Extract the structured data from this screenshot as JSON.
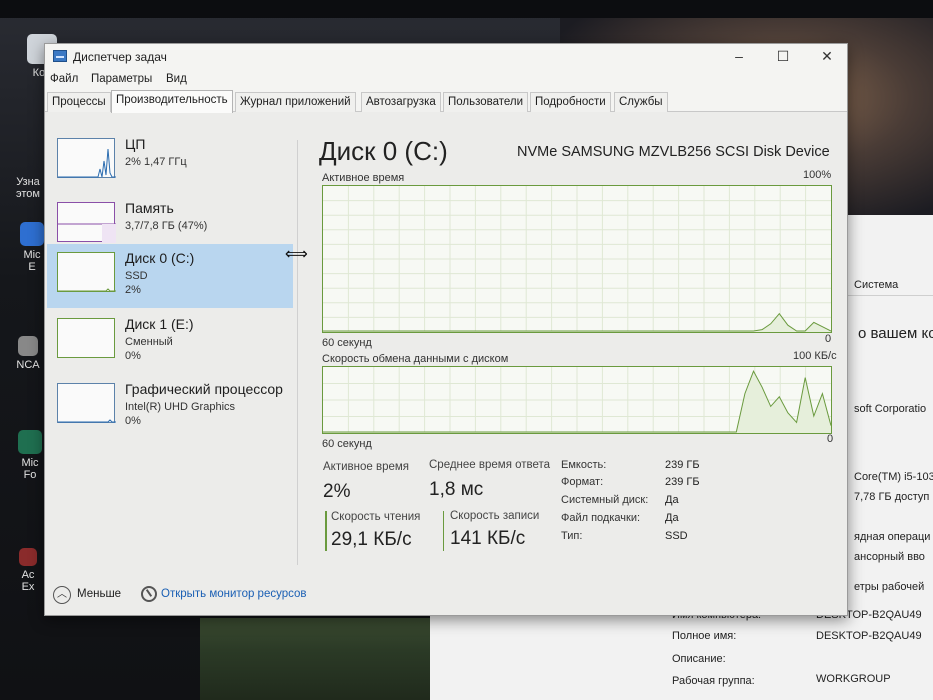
{
  "window": {
    "title": "Диспетчер задач",
    "controls": {
      "minimize": "–",
      "maximize": "☐",
      "close": "✕"
    }
  },
  "menu": [
    "Файл",
    "Параметры",
    "Вид"
  ],
  "tabs": [
    "Процессы",
    "Производительность",
    "Журнал приложений",
    "Автозагрузка",
    "Пользователи",
    "Подробности",
    "Службы"
  ],
  "active_tab": "Производительность",
  "sidebar": {
    "items": [
      {
        "name": "ЦП",
        "line1": "2% 1,47 ГГц",
        "line2": ""
      },
      {
        "name": "Память",
        "line1": "3,7/7,8 ГБ (47%)",
        "line2": ""
      },
      {
        "name": "Диск 0 (C:)",
        "line1": "SSD",
        "line2": "2%"
      },
      {
        "name": "Диск 1 (E:)",
        "line1": "Сменный",
        "line2": "0%"
      },
      {
        "name": "Графический процессор",
        "line1": "Intel(R) UHD Graphics",
        "line2": "0%"
      }
    ],
    "selected_index": 2
  },
  "main": {
    "title": "Диск 0 (C:)",
    "device": "NVMe SAMSUNG MZVLB256 SCSI Disk Device",
    "graph1": {
      "label": "Активное время",
      "max_label": "100%",
      "time_label": "60 секунд",
      "min_label": "0",
      "values": [
        0,
        0,
        0,
        0,
        0,
        0,
        0,
        0,
        0,
        0,
        0,
        0,
        0,
        0,
        0,
        0,
        0,
        0,
        0,
        0,
        0,
        0,
        0,
        0,
        0,
        0,
        0,
        0,
        0,
        0,
        0,
        0,
        0,
        0,
        0,
        0,
        0,
        0,
        0,
        0,
        0,
        0,
        0,
        0,
        0,
        0,
        0,
        0,
        0,
        0,
        0,
        1,
        5,
        12,
        4,
        0,
        0,
        6,
        3,
        0
      ]
    },
    "graph2": {
      "label": "Скорость обмена данными с диском",
      "max_label": "100 КБ/с",
      "time_label": "60 секунд",
      "min_label": "0",
      "values": [
        0,
        0,
        0,
        0,
        0,
        0,
        0,
        0,
        0,
        0,
        0,
        0,
        0,
        0,
        0,
        0,
        0,
        0,
        0,
        0,
        0,
        0,
        0,
        0,
        0,
        0,
        0,
        0,
        0,
        0,
        0,
        0,
        0,
        0,
        0,
        0,
        0,
        0,
        0,
        0,
        0,
        0,
        0,
        0,
        0,
        0,
        0,
        0,
        0,
        60,
        95,
        70,
        40,
        55,
        30,
        15,
        85,
        25,
        60,
        10
      ]
    },
    "stats": {
      "active_time_label": "Активное время",
      "active_time_value": "2%",
      "avg_response_label": "Среднее время ответа",
      "avg_response_value": "1,8 мс",
      "read_speed_label": "Скорость чтения",
      "read_speed_value": "29,1 КБ/с",
      "write_speed_label": "Скорость записи",
      "write_speed_value": "141 КБ/с"
    },
    "info": [
      {
        "label": "Емкость:",
        "value": "239 ГБ"
      },
      {
        "label": "Формат:",
        "value": "239 ГБ"
      },
      {
        "label": "Системный диск:",
        "value": "Да"
      },
      {
        "label": "Файл подкачки:",
        "value": "Да"
      },
      {
        "label": "Тип:",
        "value": "SSD"
      }
    ]
  },
  "footer": {
    "fewer_label": "Меньше",
    "open_monitor_label": "Открыть монитор ресурсов"
  },
  "desktop": {
    "icon_labels": [
      "Кор",
      "Узна",
      "этом",
      "Mic",
      "E",
      "NCA",
      "Mic",
      "Fo",
      "Ac",
      "Ex"
    ]
  },
  "background_window": {
    "lines": [
      "Система",
      "о вашем ко",
      "soft Corporatio",
      "Core(TM) i5-103",
      "7,78 ГБ доступ",
      "ядная операци",
      "ансорный вво",
      "етры рабочей"
    ],
    "rows": [
      {
        "label": "Имя компьютера:",
        "value": "DESKTOP-B2QAU49"
      },
      {
        "label": "Полное имя:",
        "value": "DESKTOP-B2QAU49"
      },
      {
        "label": "Описание:",
        "value": ""
      },
      {
        "label": "Рабочая группа:",
        "value": "WORKGROUP"
      }
    ]
  },
  "colors": {
    "disk_accent": "#6a9a3e",
    "selection": "#b9d6ef",
    "cpu_accent": "#2b6cb0",
    "link": "#1a5fb4"
  }
}
